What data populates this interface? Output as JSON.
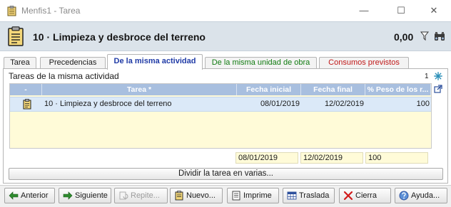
{
  "window": {
    "title": "Menfis1 - Tarea",
    "minimize": "—",
    "maximize": "☐",
    "close": "✕"
  },
  "header": {
    "title": "10 · Limpieza y desbroce del terreno",
    "value": "0,00"
  },
  "tabs": [
    {
      "label": "Tarea",
      "active": false
    },
    {
      "label": "Precedencias",
      "active": false
    },
    {
      "label": "De la misma actividad",
      "active": true
    },
    {
      "label": "De la misma unidad de obra",
      "active": false,
      "color": "#107b10"
    },
    {
      "label": "Consumos previstos",
      "active": false,
      "color": "#c01818"
    }
  ],
  "panel": {
    "section_title": "Tareas de la misma actividad",
    "count": "1"
  },
  "grid": {
    "columns": [
      "-",
      "Tarea *",
      "Fecha inicial",
      "Fecha final",
      "% Peso de los r..."
    ],
    "rows": [
      {
        "tarea": "10 · Limpieza y desbroce del terreno",
        "fecha_inicial": "08/01/2019",
        "fecha_final": "12/02/2019",
        "peso": "100"
      }
    ],
    "totals": {
      "fecha_inicial": "08/01/2019",
      "fecha_final": "12/02/2019",
      "peso": "100"
    }
  },
  "split_button": "Dividir la tarea en varias...",
  "toolbar": {
    "buttons": [
      {
        "label": "Anterior",
        "enabled": true
      },
      {
        "label": "Siguiente",
        "enabled": true
      },
      {
        "label": "Repite...",
        "enabled": false
      },
      {
        "label": "Nuevo...",
        "enabled": true
      },
      {
        "label": "Imprime",
        "enabled": true
      },
      {
        "label": "Traslada",
        "enabled": true
      },
      {
        "label": "Cierra",
        "enabled": true
      },
      {
        "label": "Ayuda...",
        "enabled": true
      }
    ]
  },
  "colors": {
    "header_bg": "#dbe3ea",
    "grid_header_bg": "#a8bfdf",
    "selected_row_bg": "#dbe9f8",
    "grid_bg": "#fffbd8",
    "active_tab_text": "#1f3aa6"
  }
}
